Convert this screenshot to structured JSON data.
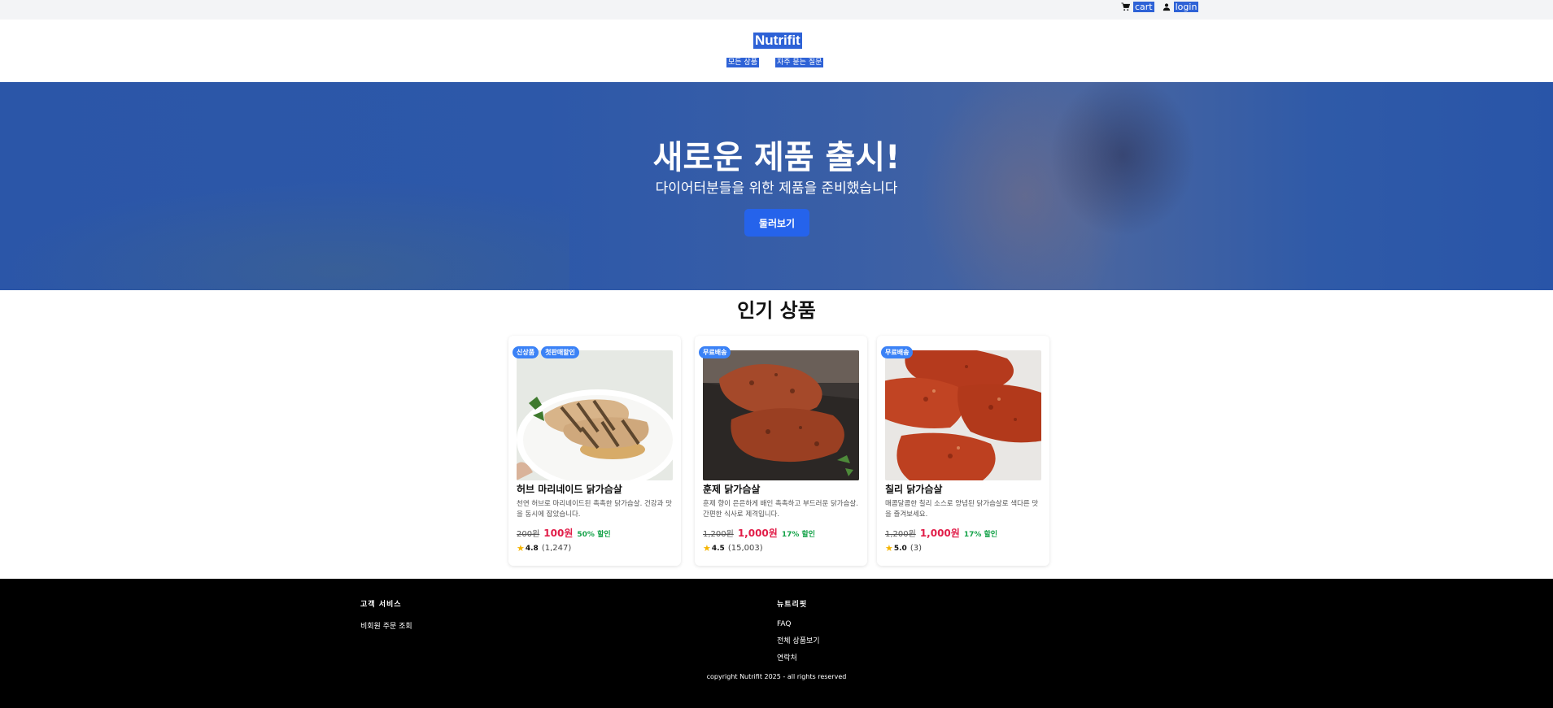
{
  "topbar": {
    "cart_label": "cart",
    "login_label": "login"
  },
  "header": {
    "brand": "Nutrifit",
    "nav": [
      {
        "label": "모든 상품"
      },
      {
        "label": "자주 묻는 질문"
      }
    ]
  },
  "hero": {
    "title": "새로운 제품 출시!",
    "subtitle": "다이어터분들을 위한 제품을 준비했습니다",
    "button_label": "둘러보기"
  },
  "popular": {
    "title": "인기 상품",
    "products": [
      {
        "badges": [
          "신상품",
          "첫판매할인"
        ],
        "name": "허브 마리네이드 닭가슴살",
        "desc": "천연 허브로 마리네이드된 촉촉한 닭가슴살. 건강과 맛을 동시에 잡았습니다.",
        "original_price": "200원",
        "sale_price": "100원",
        "discount": "50% 할인",
        "rating": "4.8",
        "review_count": "(1,247)"
      },
      {
        "badges": [
          "무료배송"
        ],
        "name": "훈제 닭가슴살",
        "desc": "훈제 향이 은은하게 배인 촉촉하고 부드러운 닭가슴살. 간편한 식사로 제격입니다.",
        "original_price": "1,200원",
        "sale_price": "1,000원",
        "discount": "17% 할인",
        "rating": "4.5",
        "review_count": "(15,003)"
      },
      {
        "badges": [
          "무료배송"
        ],
        "name": "칠리 닭가슴살",
        "desc": "매콤달콤한 칠리 소스로 양념된 닭가슴살로 색다른 맛을 즐겨보세요.",
        "original_price": "1,200원",
        "sale_price": "1,000원",
        "discount": "17% 할인",
        "rating": "5.0",
        "review_count": "(3)"
      }
    ]
  },
  "footer": {
    "customer_service": {
      "title": "고객 서비스",
      "links": [
        "비회원 주문 조회"
      ]
    },
    "company": {
      "title": "뉴트리핏",
      "links": [
        "FAQ",
        "전체 상품보기",
        "연락처"
      ]
    },
    "copyright": "copyright Nutrifit 2025 - all rights reserved"
  },
  "colors": {
    "primary": "#2563eb",
    "hero_overlay": "#2b56a8",
    "sale": "#e11d48",
    "discount": "#16a34a",
    "badge": "#3b82f6",
    "footer_bg": "#000000"
  }
}
